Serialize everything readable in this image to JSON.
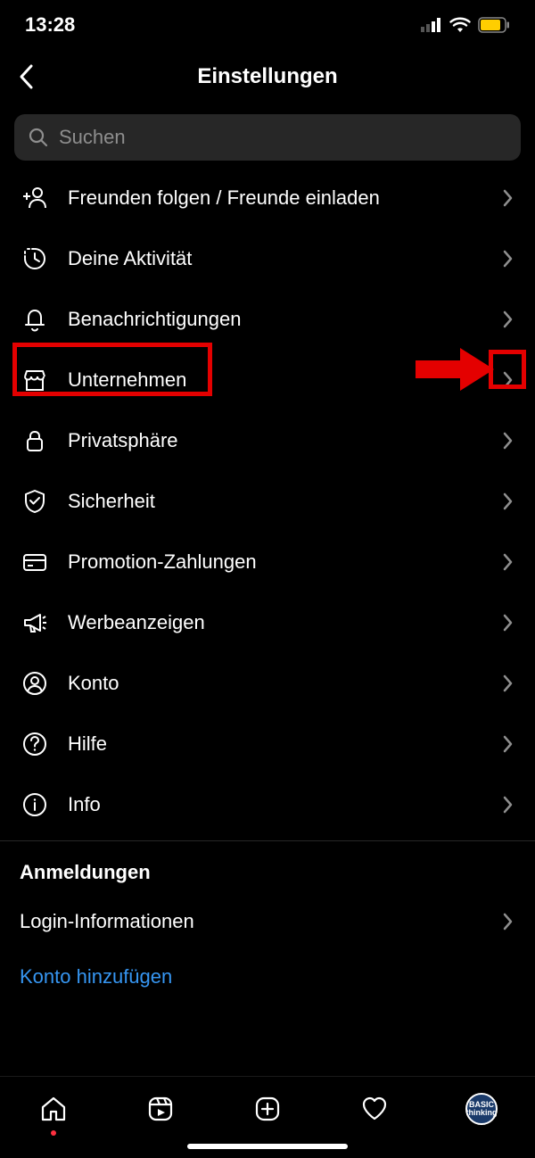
{
  "status": {
    "time": "13:28"
  },
  "header": {
    "title": "Einstellungen"
  },
  "search": {
    "placeholder": "Suchen"
  },
  "items": [
    {
      "label": "Freunden folgen / Freunde einladen"
    },
    {
      "label": "Deine Aktivität"
    },
    {
      "label": "Benachrichtigungen"
    },
    {
      "label": "Unternehmen"
    },
    {
      "label": "Privatsphäre"
    },
    {
      "label": "Sicherheit"
    },
    {
      "label": "Promotion-Zahlungen"
    },
    {
      "label": "Werbeanzeigen"
    },
    {
      "label": "Konto"
    },
    {
      "label": "Hilfe"
    },
    {
      "label": "Info"
    }
  ],
  "logins": {
    "heading": "Anmeldungen",
    "info": "Login-Informationen",
    "add": "Konto hinzufügen"
  },
  "avatar_text": "BASIC\nthinking"
}
